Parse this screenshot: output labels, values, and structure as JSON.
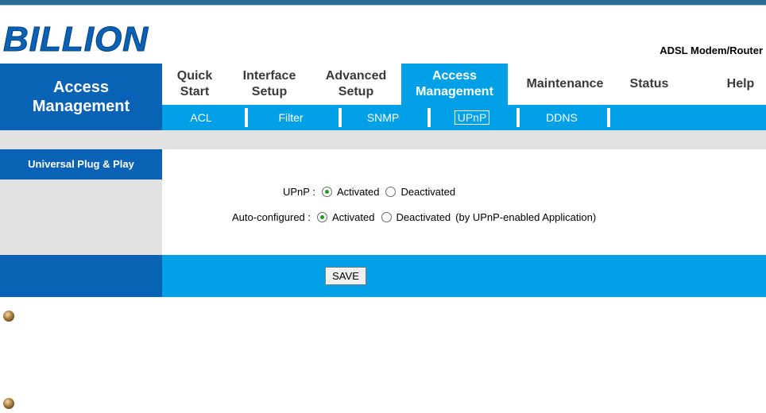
{
  "brand": {
    "logo_text": "BILLION",
    "product": "ADSL Modem/Router"
  },
  "section": {
    "title_line1": "Access",
    "title_line2": "Management"
  },
  "nav": [
    {
      "line1": "Quick",
      "line2": "Start"
    },
    {
      "line1": "Interface",
      "line2": "Setup"
    },
    {
      "line1": "Advanced",
      "line2": "Setup"
    },
    {
      "line1": "Access",
      "line2": "Management"
    },
    {
      "line1": "Maintenance",
      "line2": ""
    },
    {
      "line1": "Status",
      "line2": ""
    },
    {
      "line1": "Help",
      "line2": ""
    }
  ],
  "subnav": [
    "ACL",
    "Filter",
    "SNMP",
    "UPnP",
    "DDNS"
  ],
  "panel": {
    "label": "Universal Plug & Play"
  },
  "form": {
    "upnp": {
      "label": "UPnP :",
      "activated": "Activated",
      "deactivated": "Deactivated",
      "selected": "Activated"
    },
    "auto": {
      "label": "Auto-configured :",
      "activated": "Activated",
      "deactivated": "Deactivated",
      "note": "(by UPnP-enabled Application)",
      "selected": "Activated"
    }
  },
  "buttons": {
    "save": "SAVE"
  },
  "colors": {
    "dark_blue": "#0a62b6",
    "light_blue": "#00a0e6",
    "gray": "#e2e2e2"
  }
}
